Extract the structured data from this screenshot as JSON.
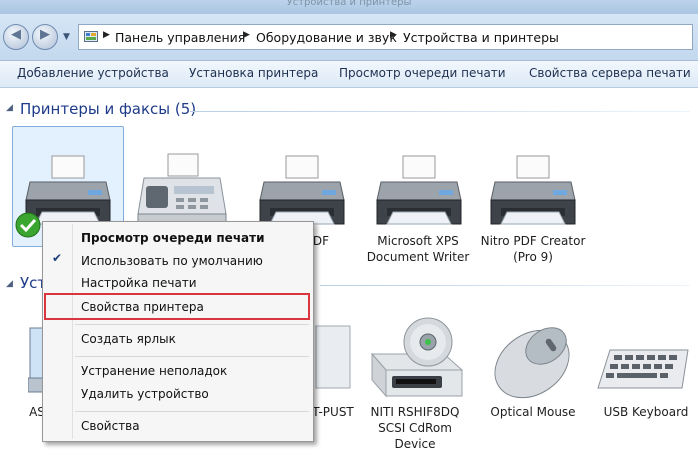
{
  "window": {
    "title": "Устройства и принтеры"
  },
  "address_bar": {
    "crumbs": [
      "Панель управления",
      "Оборудование и звук",
      "Устройства и принтеры"
    ]
  },
  "commands": [
    "Добавление устройства",
    "Установка принтера",
    "Просмотр очереди печати",
    "Свойства сервера печати"
  ],
  "printers_group": {
    "title": "Принтеры и факсы (5)"
  },
  "printers": [
    {
      "line1": "",
      "line2": ""
    },
    {
      "line1": "",
      "line2": ""
    },
    {
      "line1": "DF",
      "line2": ""
    },
    {
      "line1": "Microsoft XPS",
      "line2": "Document Writer"
    },
    {
      "line1": "Nitro PDF Creator",
      "line2": "(Pro 9)"
    }
  ],
  "devices_group": {
    "title": "Уст"
  },
  "devices": [
    {
      "line1": "AS",
      "line2": "",
      "line3": ""
    },
    {
      "line1": "T-PUST",
      "line2": "",
      "line3": ""
    },
    {
      "line1": "NITI RSHIF8DQ",
      "line2": "SCSI CdRom",
      "line3": "Device"
    },
    {
      "line1": "Optical Mouse",
      "line2": "",
      "line3": ""
    },
    {
      "line1": "USB Keyboard",
      "line2": "",
      "line3": ""
    }
  ],
  "context_menu": {
    "items": [
      {
        "label": "Просмотр очереди печати"
      },
      {
        "label": "Использовать по умолчанию"
      },
      {
        "label": "Настройка печати"
      },
      {
        "label": "Свойства принтера"
      },
      {
        "label": "Создать ярлык"
      },
      {
        "label": "Устранение неполадок"
      },
      {
        "label": "Удалить устройство"
      },
      {
        "label": "Свойства"
      }
    ]
  },
  "colors": {
    "group_title": "#1e3b8a",
    "highlight": "#d9353e",
    "default_check": "#3aa52f"
  }
}
